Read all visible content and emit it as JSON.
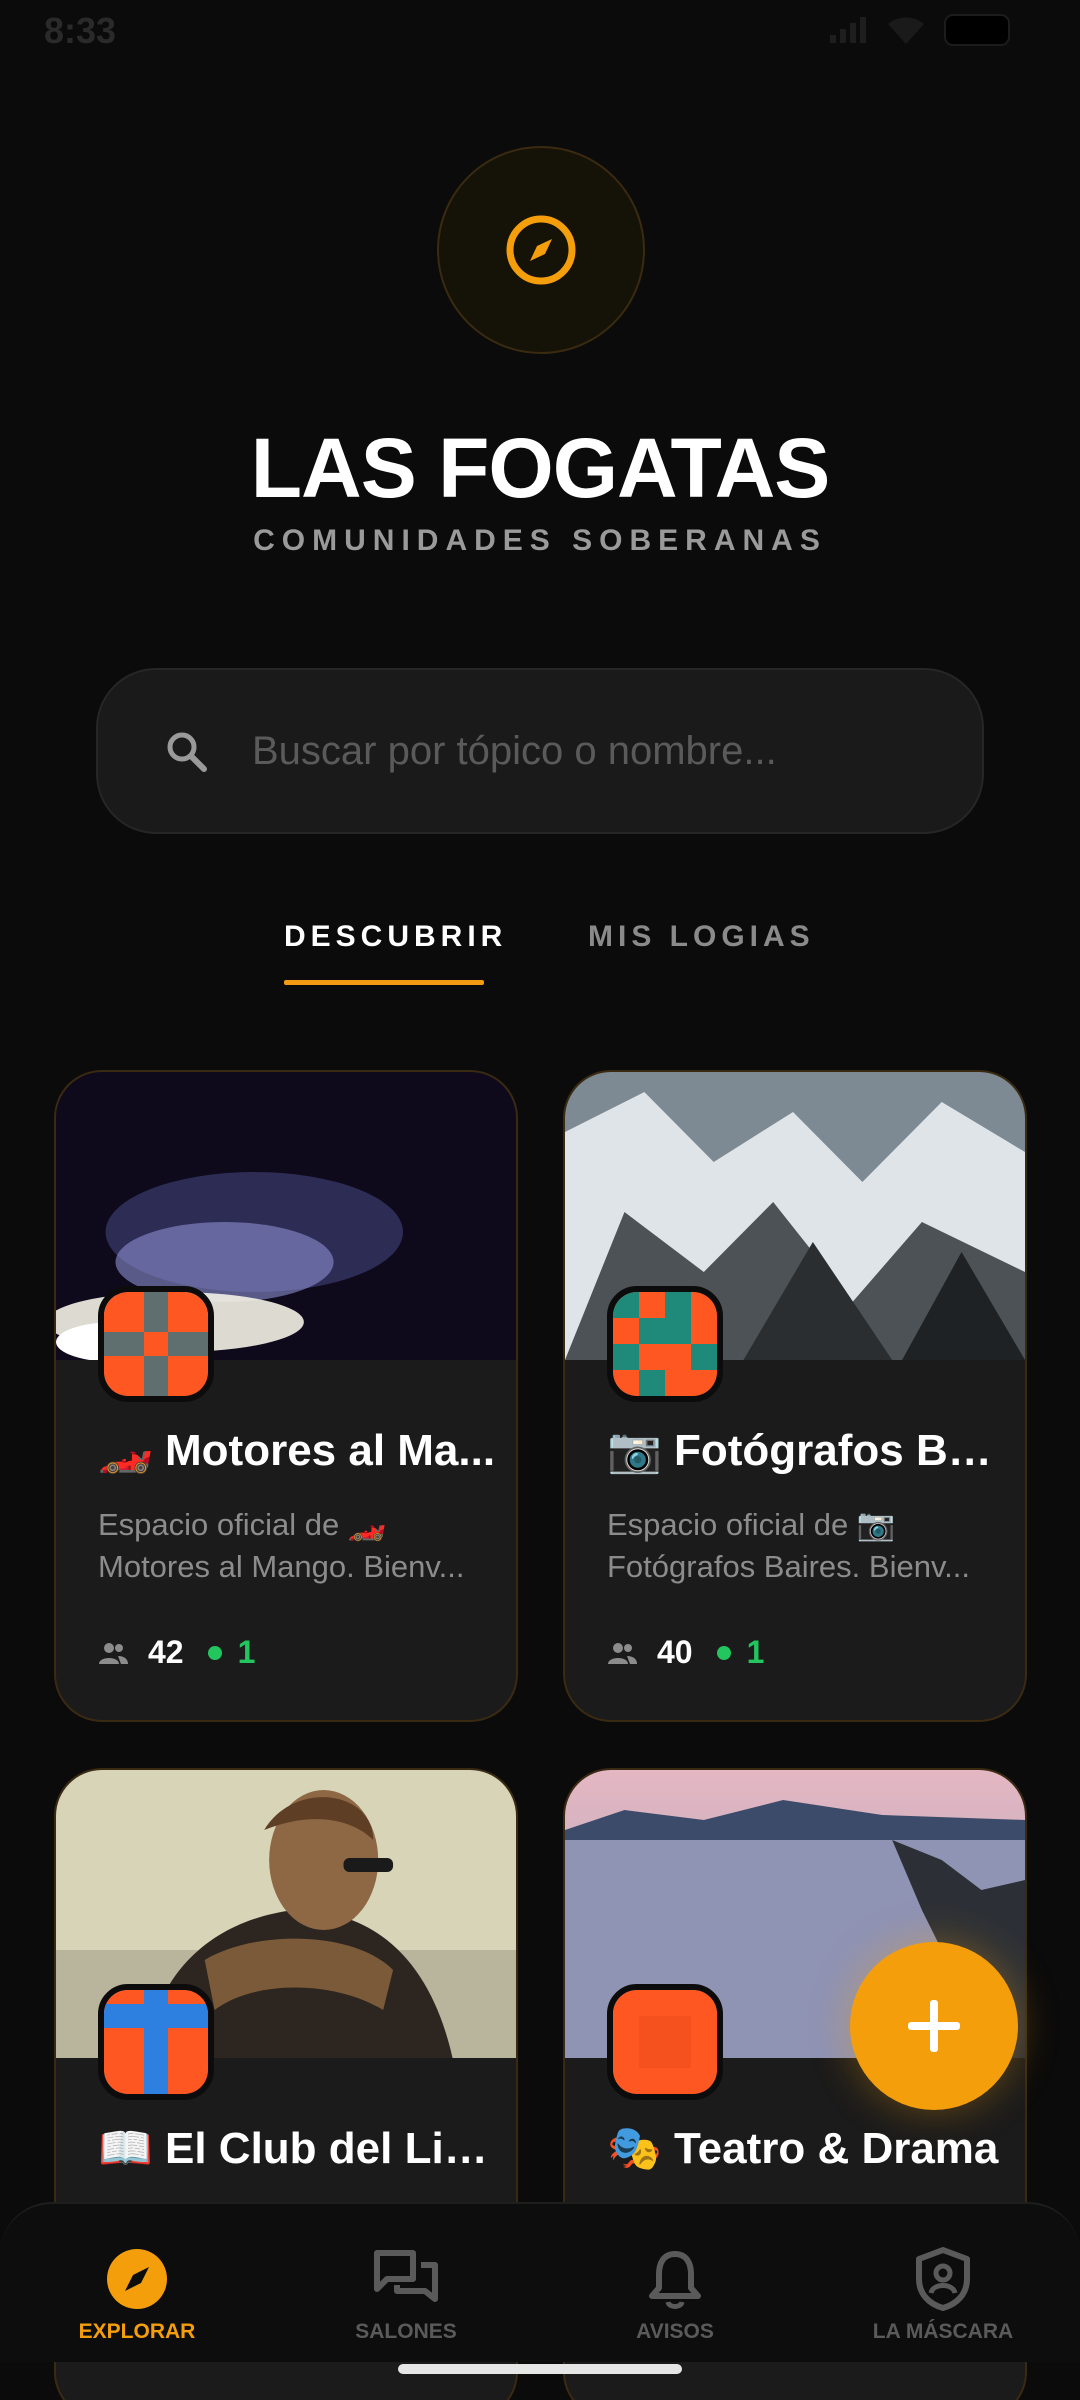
{
  "status": {
    "time": "8:33"
  },
  "hero": {
    "title": "LAS FOGATAS",
    "subtitle": "COMUNIDADES SOBERANAS"
  },
  "search": {
    "placeholder": "Buscar por tópico o nombre..."
  },
  "tabs": [
    {
      "label": "DESCUBRIR",
      "active": true
    },
    {
      "label": "MIS LOGIAS",
      "active": false
    }
  ],
  "cards": [
    {
      "title": "🏎️ Motores al Ma...",
      "desc_line1": "Espacio oficial de 🏎️",
      "desc_line2": "Motores al Mango. Bienv...",
      "members": "42",
      "online": "1"
    },
    {
      "title": "📷 Fotógrafos Bai...",
      "desc_line1": "Espacio oficial de 📷",
      "desc_line2": "Fotógrafos Baires. Bienv...",
      "members": "40",
      "online": "1"
    },
    {
      "title": "📖 El Club del Libro"
    },
    {
      "title": "🎭 Teatro & Drama"
    }
  ],
  "nav": [
    {
      "label": "EXPLORAR",
      "icon": "compass-icon",
      "active": true
    },
    {
      "label": "SALONES",
      "icon": "chat-icon",
      "active": false
    },
    {
      "label": "AVISOS",
      "icon": "bell-icon",
      "active": false
    },
    {
      "label": "LA MÁSCARA",
      "icon": "user-shield-icon",
      "active": false
    }
  ],
  "colors": {
    "accent": "#f59e0b",
    "online": "#22c55e",
    "background": "#0b0b0b"
  }
}
